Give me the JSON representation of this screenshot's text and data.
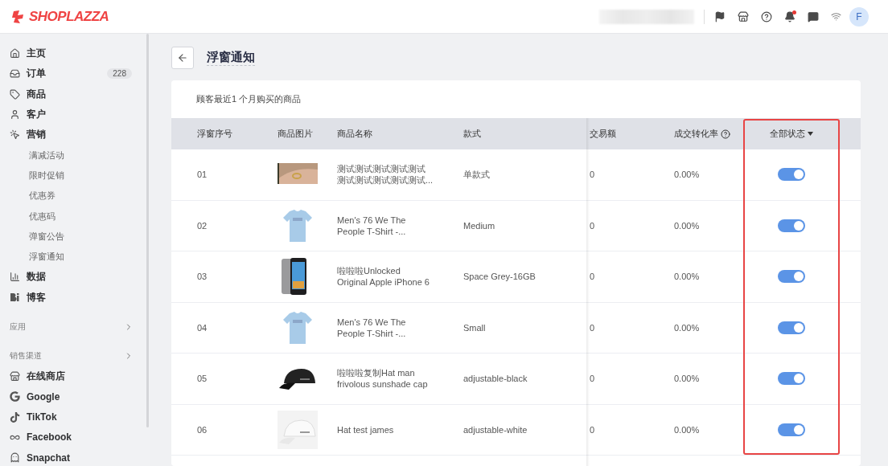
{
  "header": {
    "logo": "SHOPLAZZA",
    "avatar": "F",
    "notification_dot": true
  },
  "sidebar": {
    "items": [
      {
        "kind": "home",
        "label": "主页"
      },
      {
        "kind": "orders",
        "label": "订单",
        "badge": "228"
      },
      {
        "kind": "products",
        "label": "商品"
      },
      {
        "kind": "customers",
        "label": "客户"
      },
      {
        "kind": "marketing",
        "label": "营销",
        "children": [
          {
            "label": "满减活动"
          },
          {
            "label": "限时促销"
          },
          {
            "label": "优惠券"
          },
          {
            "label": "优惠码"
          },
          {
            "label": "弹窗公告"
          },
          {
            "label": "浮窗通知"
          }
        ]
      },
      {
        "kind": "analytics",
        "label": "数据"
      },
      {
        "kind": "blog",
        "label": "博客"
      }
    ],
    "sections": [
      {
        "label": "应用"
      },
      {
        "label": "销售渠道"
      }
    ],
    "channels": [
      {
        "kind": "store",
        "label": "在线商店"
      },
      {
        "kind": "google",
        "label": "Google"
      },
      {
        "kind": "tiktok",
        "label": "TikTok"
      },
      {
        "kind": "facebook",
        "label": "Facebook"
      },
      {
        "kind": "snapchat",
        "label": "Snapchat"
      }
    ]
  },
  "page": {
    "title": "浮窗通知",
    "subtitle": "顾客最近1 个月购买的商品"
  },
  "table": {
    "columns": [
      "浮窗序号",
      "商品图片",
      "商品名称",
      "款式",
      "交易额",
      "成交转化率",
      "全部状态"
    ],
    "rows": [
      {
        "index": "01",
        "image": {
          "kind": "picture"
        },
        "name": [
          "测试测试测试测试测试",
          "测试测试测试测试测试..."
        ],
        "variant": "单款式",
        "sales": "0",
        "rate": "0.00%",
        "on": true
      },
      {
        "index": "02",
        "image": {
          "kind": "picture"
        },
        "name": [
          "Men's 76 We The",
          "People T-Shirt -..."
        ],
        "variant": "Medium",
        "sales": "0",
        "rate": "0.00%",
        "on": true
      },
      {
        "index": "03",
        "image": {
          "kind": "picture"
        },
        "name": [
          "啦啦啦Unlocked",
          "Original Apple iPhone 6"
        ],
        "variant": "Space Grey-16GB",
        "sales": "0",
        "rate": "0.00%",
        "on": true
      },
      {
        "index": "04",
        "image": {
          "kind": "picture"
        },
        "name": [
          "Men's 76 We The",
          "People T-Shirt -..."
        ],
        "variant": "Small",
        "sales": "0",
        "rate": "0.00%",
        "on": true
      },
      {
        "index": "05",
        "image": {
          "kind": "picture"
        },
        "name": [
          "啦啦啦复制Hat man",
          "frivolous sunshade cap"
        ],
        "variant": "adjustable-black",
        "sales": "0",
        "rate": "0.00%",
        "on": true
      },
      {
        "index": "06",
        "image": {
          "kind": "picture"
        },
        "name": [
          "Hat test james"
        ],
        "variant": "adjustable-white",
        "sales": "0",
        "rate": "0.00%",
        "on": true
      }
    ]
  }
}
